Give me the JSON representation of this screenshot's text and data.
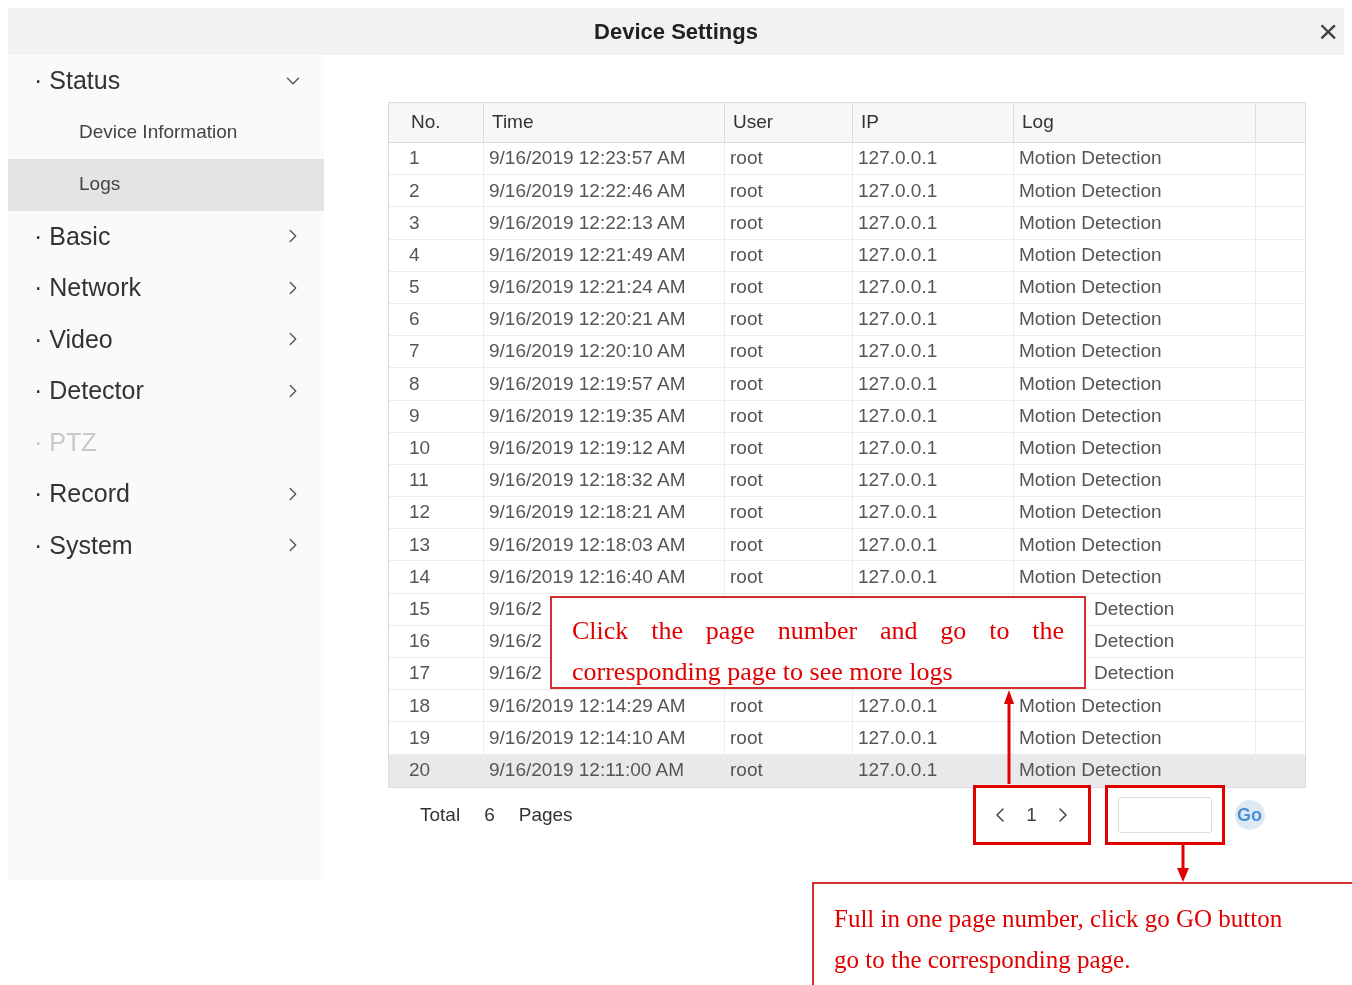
{
  "window": {
    "title": "Device Settings",
    "close": "×"
  },
  "sidebar": {
    "items": [
      {
        "label": "· Status",
        "expanded": true,
        "disabled": false,
        "children": [
          {
            "label": "Device Information",
            "selected": false
          },
          {
            "label": "Logs",
            "selected": true
          }
        ]
      },
      {
        "label": "· Basic",
        "expanded": false,
        "disabled": false
      },
      {
        "label": "· Network",
        "expanded": false,
        "disabled": false
      },
      {
        "label": "· Video",
        "expanded": false,
        "disabled": false
      },
      {
        "label": "· Detector",
        "expanded": false,
        "disabled": false
      },
      {
        "label": "· PTZ",
        "expanded": false,
        "disabled": true
      },
      {
        "label": "· Record",
        "expanded": false,
        "disabled": false
      },
      {
        "label": "· System",
        "expanded": false,
        "disabled": false
      }
    ]
  },
  "table": {
    "columns": [
      "No.",
      "Time",
      "User",
      "IP",
      "Log"
    ],
    "rows": [
      {
        "no": "1",
        "time": "9/16/2019 12:23:57 AM",
        "user": "root",
        "ip": "127.0.0.1",
        "log": "Motion Detection",
        "selected": false
      },
      {
        "no": "2",
        "time": "9/16/2019 12:22:46 AM",
        "user": "root",
        "ip": "127.0.0.1",
        "log": "Motion Detection",
        "selected": false
      },
      {
        "no": "3",
        "time": "9/16/2019 12:22:13 AM",
        "user": "root",
        "ip": "127.0.0.1",
        "log": "Motion Detection",
        "selected": false
      },
      {
        "no": "4",
        "time": "9/16/2019 12:21:49 AM",
        "user": "root",
        "ip": "127.0.0.1",
        "log": "Motion Detection",
        "selected": false
      },
      {
        "no": "5",
        "time": "9/16/2019 12:21:24 AM",
        "user": "root",
        "ip": "127.0.0.1",
        "log": "Motion Detection",
        "selected": false
      },
      {
        "no": "6",
        "time": "9/16/2019 12:20:21 AM",
        "user": "root",
        "ip": "127.0.0.1",
        "log": "Motion Detection",
        "selected": false
      },
      {
        "no": "7",
        "time": "9/16/2019 12:20:10 AM",
        "user": "root",
        "ip": "127.0.0.1",
        "log": "Motion Detection",
        "selected": false
      },
      {
        "no": "8",
        "time": "9/16/2019 12:19:57 AM",
        "user": "root",
        "ip": "127.0.0.1",
        "log": "Motion Detection",
        "selected": false
      },
      {
        "no": "9",
        "time": "9/16/2019 12:19:35 AM",
        "user": "root",
        "ip": "127.0.0.1",
        "log": "Motion Detection",
        "selected": false
      },
      {
        "no": "10",
        "time": "9/16/2019 12:19:12 AM",
        "user": "root",
        "ip": "127.0.0.1",
        "log": "Motion Detection",
        "selected": false
      },
      {
        "no": "11",
        "time": "9/16/2019 12:18:32 AM",
        "user": "root",
        "ip": "127.0.0.1",
        "log": "Motion Detection",
        "selected": false
      },
      {
        "no": "12",
        "time": "9/16/2019 12:18:21 AM",
        "user": "root",
        "ip": "127.0.0.1",
        "log": "Motion Detection",
        "selected": false
      },
      {
        "no": "13",
        "time": "9/16/2019 12:18:03 AM",
        "user": "root",
        "ip": "127.0.0.1",
        "log": "Motion Detection",
        "selected": false
      },
      {
        "no": "14",
        "time": "9/16/2019 12:16:40 AM",
        "user": "root",
        "ip": "127.0.0.1",
        "log": "Motion Detection",
        "selected": false
      },
      {
        "no": "15",
        "kind": "partial",
        "time": "9/16/2",
        "log": "Detection",
        "selected": false
      },
      {
        "no": "16",
        "kind": "partial",
        "time": "9/16/2",
        "log": "Detection",
        "selected": false
      },
      {
        "no": "17",
        "kind": "partial",
        "time": "9/16/2",
        "log": "Detection",
        "selected": false
      },
      {
        "no": "18",
        "time": "9/16/2019 12:14:29 AM",
        "user": "root",
        "ip": "127.0.0.1",
        "log": "Motion Detection",
        "selected": false
      },
      {
        "no": "19",
        "time": "9/16/2019 12:14:10 AM",
        "user": "root",
        "ip": "127.0.0.1",
        "log": "Motion Detection",
        "selected": false
      },
      {
        "no": "20",
        "time": "9/16/2019 12:11:00 AM",
        "user": "root",
        "ip": "127.0.0.1",
        "log": "Motion Detection",
        "selected": true
      }
    ]
  },
  "footer": {
    "total_label": "Total",
    "total": "6",
    "pages_label": "Pages",
    "page": "1",
    "go": "Go"
  },
  "annotations": [
    {
      "text": "Click the page number and go to the corresponding page to see more logs"
    },
    {
      "text": "Full in one page number, click go GO button"
    },
    {
      "text": "go to the corresponding page."
    }
  ]
}
